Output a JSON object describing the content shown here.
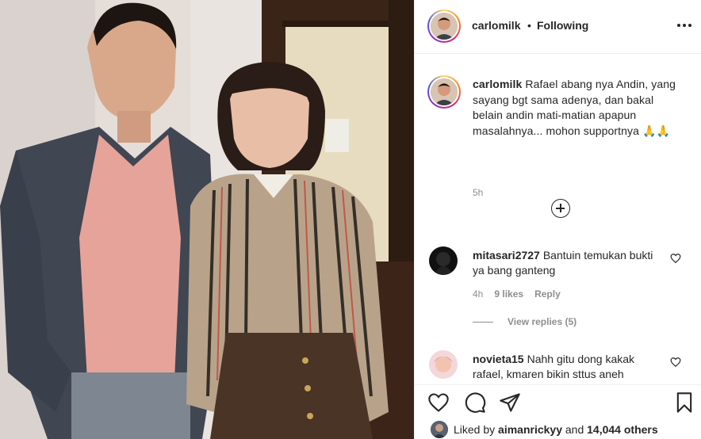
{
  "post": {
    "author": "carlomilk",
    "separator": "•",
    "follow_state": "Following",
    "more_icon": "more-horizontal-icon"
  },
  "caption": {
    "username": "carlomilk",
    "text": "Rafael abang nya Andin, yang sayang bgt sama adenya, dan bakal belain andin mati-matian apapun masalahnya... mohon supportnya 🙏🙏",
    "time": "5h"
  },
  "load_more_icon": "plus-circle-icon",
  "comments": [
    {
      "username": "mitasari2727",
      "text": "Bantuin temukan bukti ya bang ganteng",
      "time": "4h",
      "likes": "9 likes",
      "reply": "Reply",
      "view_replies": "View replies (5)"
    },
    {
      "username": "novieta15",
      "text": "Nahh gitu dong kakak rafael, kmaren bikin sttus aneh"
    }
  ],
  "actions": {
    "like_icon": "heart-icon",
    "comment_icon": "comment-icon",
    "share_icon": "paper-plane-icon",
    "save_icon": "bookmark-icon"
  },
  "liked_by": {
    "prefix": "Liked by",
    "user": "aimanrickyy",
    "and": "and",
    "others": "14,044 others"
  }
}
